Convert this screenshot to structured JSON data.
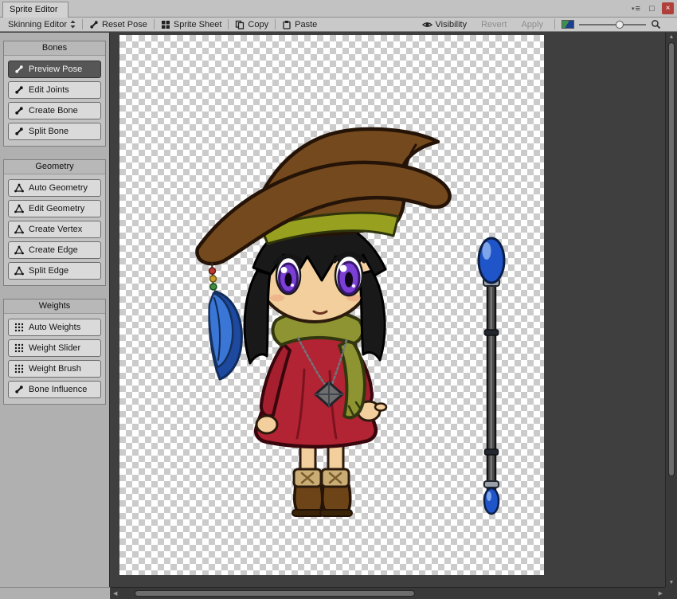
{
  "window": {
    "title": "Sprite Editor",
    "controls": {
      "menu_caret": "▾",
      "menu": "≡",
      "maximize": "□",
      "close": "×"
    }
  },
  "toolbar": {
    "mode_label": "Skinning Editor",
    "reset": "Reset Pose",
    "sprite_sheet": "Sprite Sheet",
    "copy": "Copy",
    "paste": "Paste",
    "visibility": "Visibility",
    "revert": "Revert",
    "apply": "Apply",
    "zoom_slider_fraction": 0.55
  },
  "sidebar": {
    "panels": [
      {
        "title": "Bones",
        "buttons": [
          {
            "label": "Preview Pose",
            "selected": true
          },
          {
            "label": "Edit Joints"
          },
          {
            "label": "Create Bone"
          },
          {
            "label": "Split Bone"
          }
        ]
      },
      {
        "title": "Geometry",
        "buttons": [
          {
            "label": "Auto Geometry"
          },
          {
            "label": "Edit Geometry"
          },
          {
            "label": "Create Vertex"
          },
          {
            "label": "Create Edge"
          },
          {
            "label": "Split Edge"
          }
        ]
      },
      {
        "title": "Weights",
        "buttons": [
          {
            "label": "Auto Weights"
          },
          {
            "label": "Weight Slider"
          },
          {
            "label": "Weight Brush"
          },
          {
            "label": "Bone Influence"
          }
        ]
      }
    ]
  },
  "palette": {
    "canvas_surround": "#3f3f3f",
    "checker_light": "#ffffff",
    "checker_dark": "#cbcbcb",
    "selected_button": "#565656",
    "hat_brown": "#74491d",
    "hat_band_olive": "#97a11f",
    "dress_red": "#b22433",
    "scarf_olive": "#8d9431",
    "eye_purple": "#7a3fd4",
    "skin": "#f2cf9d",
    "hair_black": "#191919",
    "boot_brown": "#6d4418",
    "boot_cuff_tan": "#c9ad74",
    "staff_gem_blue": "#1f55c8",
    "feather_blue": "#3a76d6"
  }
}
